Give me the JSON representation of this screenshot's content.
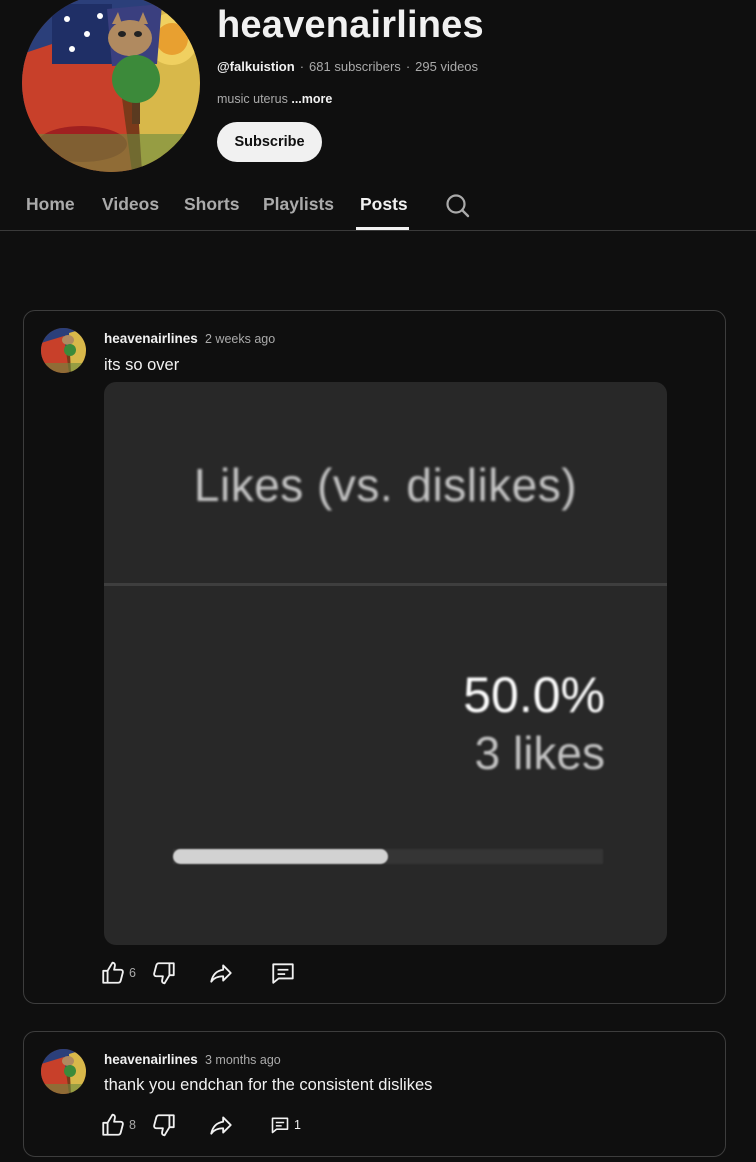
{
  "channel": {
    "name": "heavenairlines",
    "handle": "@falkuistion",
    "subscribers": "681 subscribers",
    "videos": "295 videos",
    "description": "music uterus",
    "more_label": "...more",
    "subscribe_label": "Subscribe"
  },
  "tabs": [
    {
      "label": "Home"
    },
    {
      "label": "Videos"
    },
    {
      "label": "Shorts"
    },
    {
      "label": "Playlists"
    },
    {
      "label": "Posts",
      "active": true
    }
  ],
  "posts": [
    {
      "author": "heavenairlines",
      "time": "2 weeks ago",
      "text": "its so over",
      "likes": "6",
      "comments": "",
      "image": {
        "title": "Likes (vs. dislikes)",
        "percent": "50.0%",
        "likes_text": "3 likes",
        "like_ratio": 0.5
      }
    },
    {
      "author": "heavenairlines",
      "time": "3 months ago",
      "text": "thank you endchan for the consistent dislikes",
      "likes": "8",
      "comments": "1"
    }
  ],
  "icons": [
    "search-icon",
    "thumbs-up-icon",
    "thumbs-down-icon",
    "share-icon",
    "comment-icon"
  ]
}
